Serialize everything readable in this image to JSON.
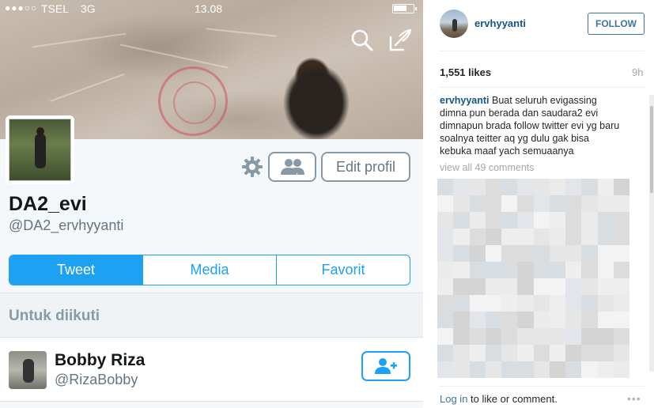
{
  "twitter": {
    "status": {
      "signal": "●●●○○",
      "carrier": "TSEL",
      "network": "3G",
      "time": "13.08"
    },
    "banner_icons": [
      "search-icon",
      "compose-icon"
    ],
    "profile": {
      "display_name": "DA2_evi",
      "handle": "@DA2_ervhyyanti",
      "edit_label": "Edit profil"
    },
    "tabs": [
      {
        "label": "Tweet",
        "active": true
      },
      {
        "label": "Media",
        "active": false
      },
      {
        "label": "Favorit",
        "active": false
      }
    ],
    "section_title": "Untuk diikuti",
    "suggestion": {
      "name": "Bobby Riza",
      "handle": "@RizaBobby"
    },
    "colors": {
      "accent": "#1da1f2",
      "muted": "#66757f"
    }
  },
  "instagram": {
    "username": "ervhyyanti",
    "follow_label": "FOLLOW",
    "likes": "1,551 likes",
    "time_ago": "9h",
    "caption_user": "ervhyyanti",
    "caption_text": " Buat seluruh evigassing dimna pun berada dan saudara2 evi dimnapun brada follow twitter evi yg baru soalnya teitter aq yg dulu gak bisa kebuka maaf yach semuaanya",
    "view_all": "view all 49 comments",
    "login_link": "Log in",
    "login_rest": " to like or comment.",
    "more": "•••",
    "colors": {
      "link": "#125688",
      "button": "#3f729b"
    }
  }
}
